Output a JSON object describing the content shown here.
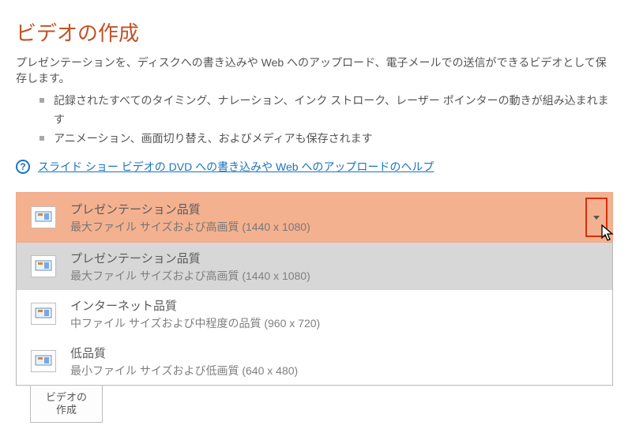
{
  "title": "ビデオの作成",
  "intro": "プレゼンテーションを、ディスクへの書き込みや Web へのアップロード、電子メールでの送信ができるビデオとして保存します。",
  "bullets": [
    "記録されたすべてのタイミング、ナレーション、インク ストローク、レーザー ポインターの動きが組み込まれます",
    "アニメーション、画面切り替え、およびメディアも保存されます"
  ],
  "help_icon_glyph": "?",
  "help_link": "スライド ショー ビデオの DVD への書き込みや Web へのアップロードのヘルプ",
  "quality_selected": {
    "label": "プレゼンテーション品質",
    "desc": "最大ファイル サイズおよび高画質 (1440 x 1080)"
  },
  "quality_options": [
    {
      "label": "プレゼンテーション品質",
      "desc": "最大ファイル サイズおよび高画質 (1440 x 1080)"
    },
    {
      "label": "インターネット品質",
      "desc": "中ファイル サイズおよび中程度の品質 (960 x 720)"
    },
    {
      "label": "低品質",
      "desc": "最小ファイル サイズおよび低画質 (640 x 480)"
    }
  ],
  "create_button": "ビデオの\n作成"
}
